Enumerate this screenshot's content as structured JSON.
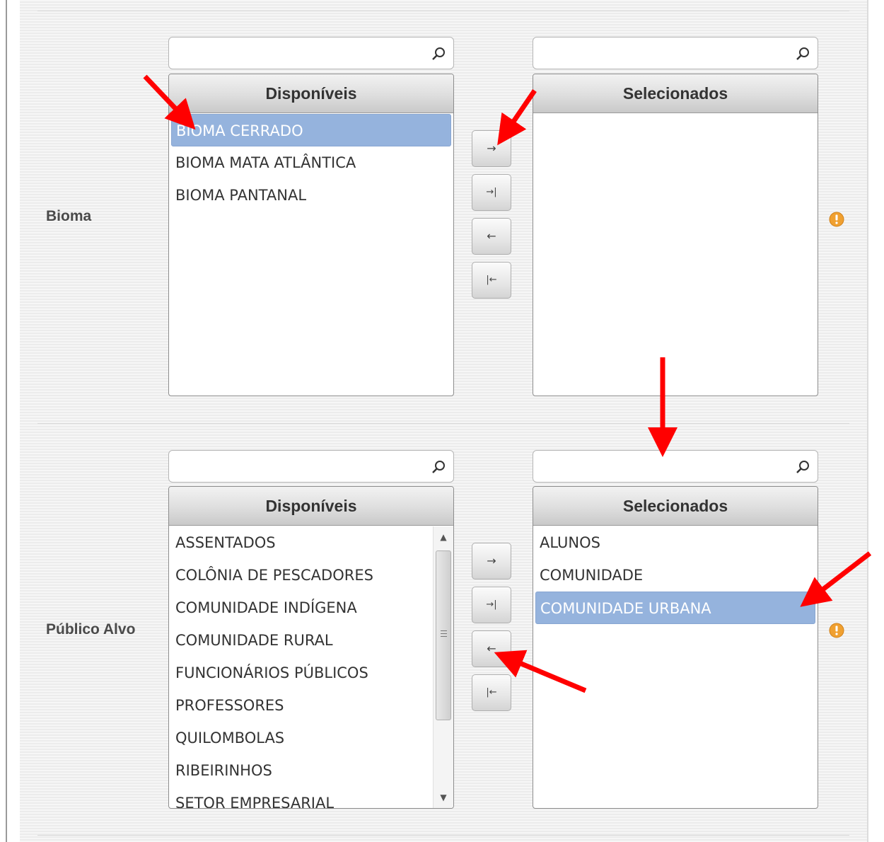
{
  "colors": {
    "accent": "#95b3dd",
    "annotation": "#ff0000",
    "warning": "#f0a030"
  },
  "icons": {
    "search": "search-icon",
    "move_right": "→",
    "move_all_right": "→|",
    "move_left": "←",
    "move_all_left": "|←",
    "warning": "warning-icon"
  },
  "bioma": {
    "label": "Bioma",
    "available": {
      "search_value": "",
      "header": "Disponíveis",
      "items": [
        "BIOMA CERRADO",
        "BIOMA MATA ATLÂNTICA",
        "BIOMA PANTANAL"
      ],
      "selected_item": "BIOMA CERRADO"
    },
    "selected": {
      "search_value": "",
      "header": "Selecionados",
      "items": []
    }
  },
  "publico_alvo": {
    "label": "Público Alvo",
    "available": {
      "search_value": "",
      "header": "Disponíveis",
      "items": [
        "ASSENTADOS",
        "COLÔNIA DE PESCADORES",
        "COMUNIDADE INDÍGENA",
        "COMUNIDADE RURAL",
        "FUNCIONÁRIOS PÚBLICOS",
        "PROFESSORES",
        "QUILOMBOLAS",
        "RIBEIRINHOS",
        "SETOR EMPRESARIAL"
      ]
    },
    "selected": {
      "search_value": "",
      "header": "Selecionados",
      "items": [
        "ALUNOS",
        "COMUNIDADE",
        "COMUNIDADE URBANA"
      ],
      "selected_item": "COMUNIDADE URBANA"
    }
  }
}
